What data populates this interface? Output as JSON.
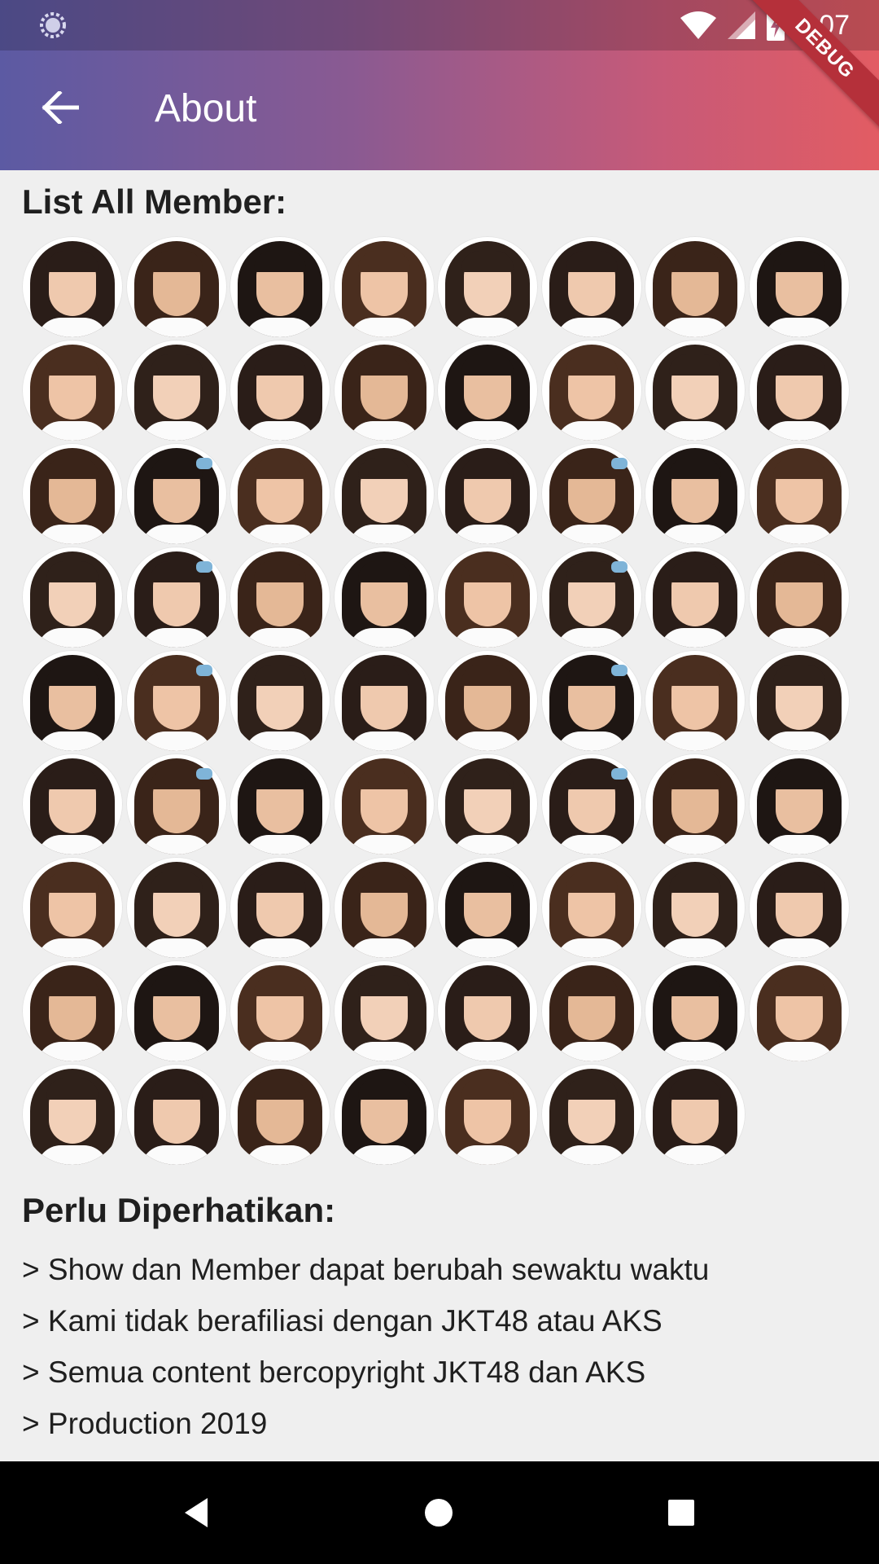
{
  "status_bar": {
    "time": "6:07",
    "debug_label": "DEBUG"
  },
  "app_bar": {
    "title": "About",
    "back_icon": "arrow-left-icon"
  },
  "members": {
    "title": "List All Member:",
    "count": 71,
    "row_counts": [
      8,
      8,
      8,
      8,
      8,
      8,
      8,
      8,
      7
    ]
  },
  "notes": {
    "title": "Perlu Diperhatikan:",
    "lines": [
      "> Show dan Member dapat berubah sewaktu waktu",
      "> Kami tidak berafiliasi dengan JKT48 atau AKS",
      "> Semua content bercopyright JKT48 dan AKS",
      "> Production 2019"
    ]
  },
  "nav": {
    "back": "nav-back-icon",
    "home": "nav-home-icon",
    "recents": "nav-recents-icon"
  },
  "colors": {
    "gradient_start": "#5c5aa3",
    "gradient_end": "#e25c63",
    "background": "#efefef",
    "nav_bar": "#000000"
  }
}
